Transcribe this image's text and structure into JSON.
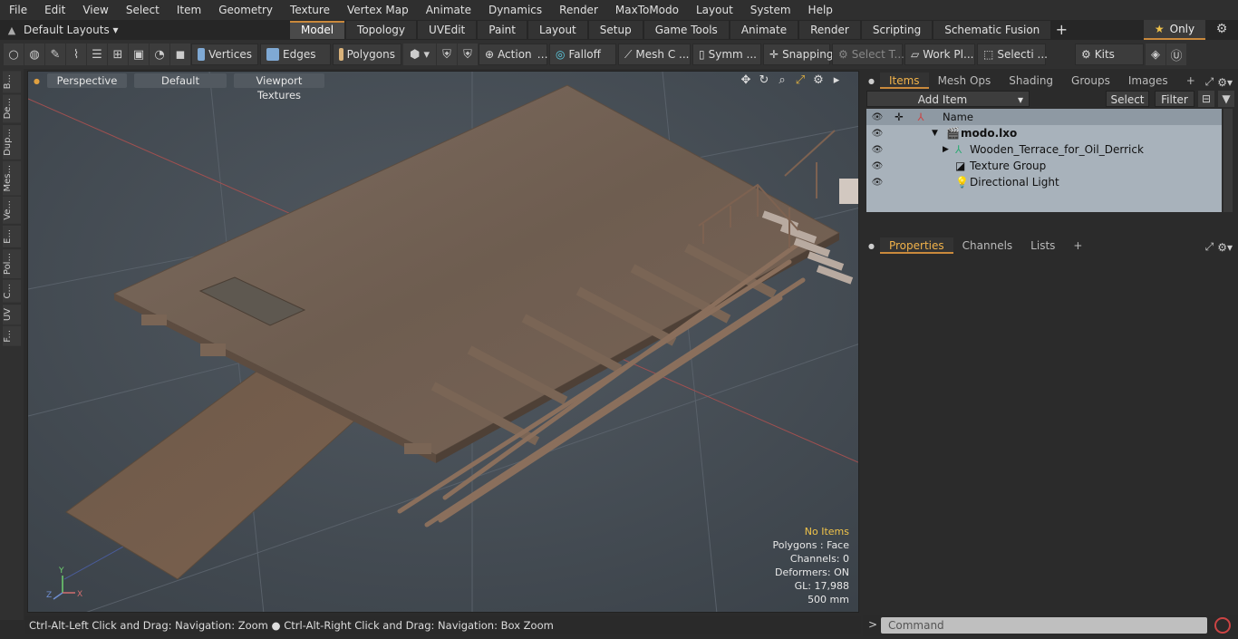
{
  "menu": [
    "File",
    "Edit",
    "View",
    "Select",
    "Item",
    "Geometry",
    "Texture",
    "Vertex Map",
    "Animate",
    "Dynamics",
    "Render",
    "MaxToModo",
    "Layout",
    "System",
    "Help"
  ],
  "layouts": {
    "label": "Default Layouts ▾"
  },
  "tabs": [
    "Model",
    "Topology",
    "UVEdit",
    "Paint",
    "Layout",
    "Setup",
    "Game Tools",
    "Animate",
    "Render",
    "Scripting",
    "Schematic Fusion"
  ],
  "only_label": "Only",
  "toolbar": {
    "vertices": "Vertices",
    "edges": "Edges",
    "polygons": "Polygons",
    "action": "Action",
    "falloff": "Falloff",
    "mesh": "Mesh C ...",
    "symm": "Symm ...",
    "snapping": "Snapping",
    "select_t": "Select T...",
    "work_pl": "Work Pl...",
    "selecti": "Selecti ...",
    "kits": "Kits"
  },
  "left_strip": [
    "B...",
    "De...",
    "Dup...",
    "Mes...",
    "Ve...",
    "E...",
    "Pol...",
    "C...",
    "UV",
    "F..."
  ],
  "viewport": {
    "perspective": "Perspective",
    "default": "Default",
    "textures": "Viewport Textures",
    "info": {
      "items": "No Items",
      "polygons": "Polygons : Face",
      "channels": "Channels: 0",
      "deformers": "Deformers: ON",
      "gl": "GL: 17,988",
      "scale": "500 mm"
    }
  },
  "status": "Ctrl-Alt-Left Click and Drag: Navigation: Zoom ● Ctrl-Alt-Right Click and Drag: Navigation: Box Zoom",
  "panel_tabs": [
    "Items",
    "Mesh Ops",
    "Shading",
    "Groups",
    "Images"
  ],
  "add_item": "Add Item",
  "select_btn": "Select",
  "filter_btn": "Filter",
  "tree": {
    "name_header": "Name",
    "rows": [
      "modo.lxo",
      "Wooden_Terrace_for_Oil_Derrick",
      "Texture Group",
      "Directional Light"
    ]
  },
  "prop_tabs": [
    "Properties",
    "Channels",
    "Lists"
  ],
  "command_placeholder": "Command"
}
